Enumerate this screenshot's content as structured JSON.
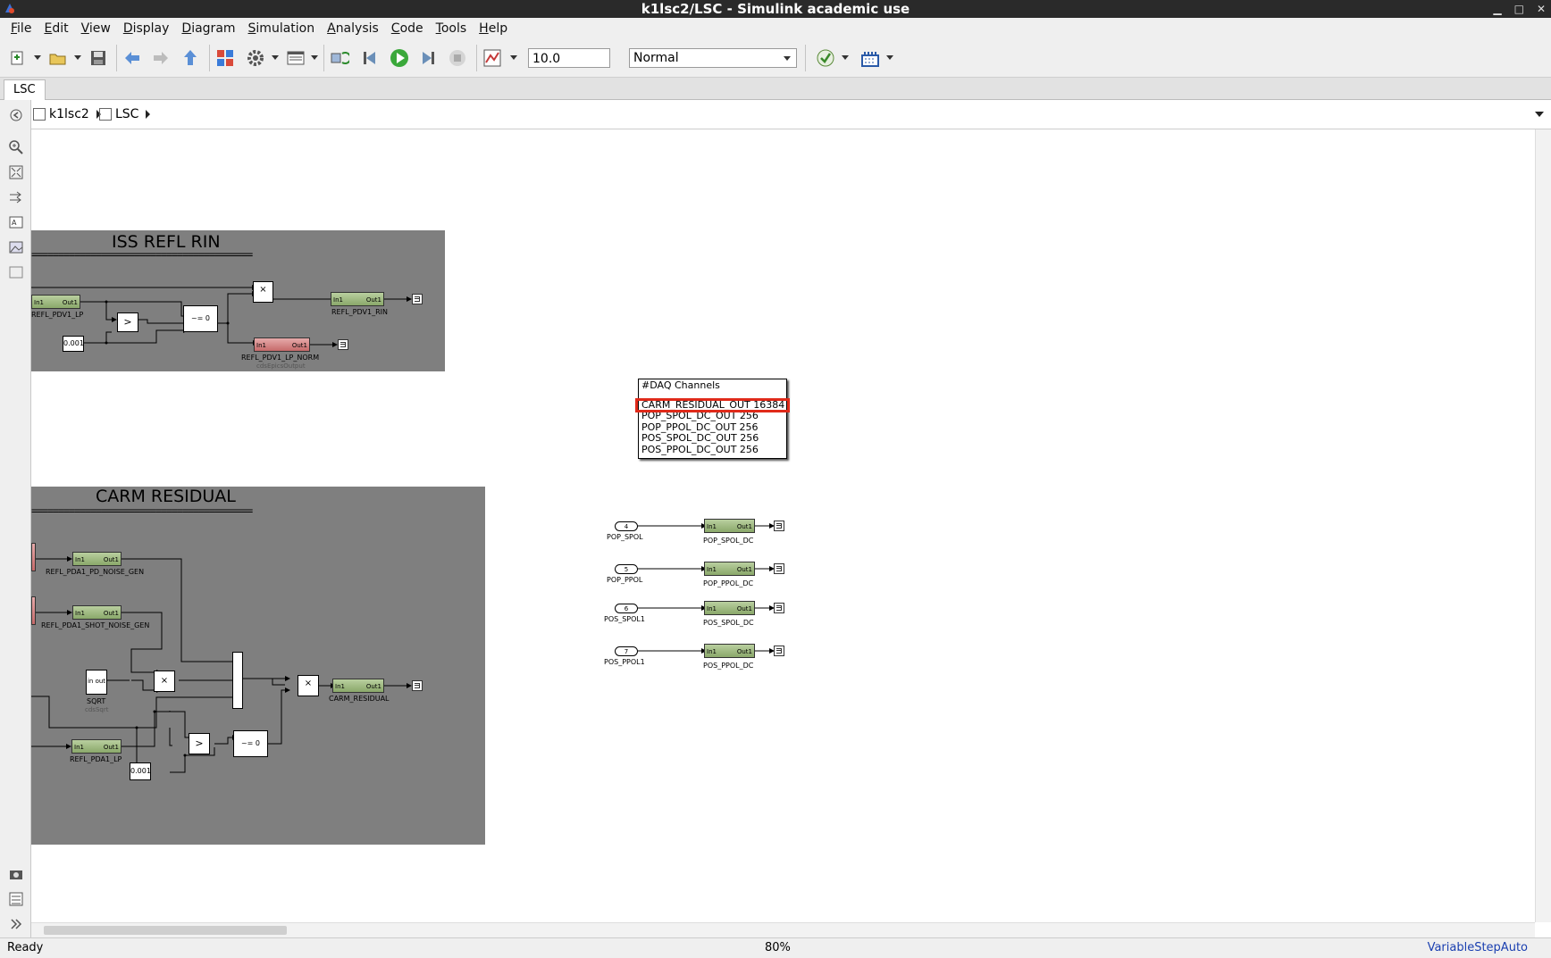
{
  "window": {
    "title": "k1lsc2/LSC - Simulink academic use"
  },
  "menu": [
    "File",
    "Edit",
    "View",
    "Display",
    "Diagram",
    "Simulation",
    "Analysis",
    "Code",
    "Tools",
    "Help"
  ],
  "toolbar": {
    "stop_time": "10.0",
    "sim_mode": "Normal",
    "icons": [
      "new-model-icon",
      "open-icon",
      "save-icon",
      "back-icon",
      "forward-icon",
      "up-icon",
      "library-browser-icon",
      "model-settings-icon",
      "model-explorer-icon",
      "update-diagram-icon",
      "step-back-icon",
      "run-icon",
      "step-forward-icon",
      "stop-icon",
      "data-inspector-icon",
      "model-advisor-icon",
      "build-icon"
    ]
  },
  "tabs": [
    {
      "label": "LSC"
    }
  ],
  "breadcrumb": {
    "items": [
      {
        "label": "k1lsc2"
      },
      {
        "label": "LSC"
      }
    ]
  },
  "diagram": {
    "iss_area": {
      "title": "ISS REFL RIN",
      "rule": "=========================================",
      "blocks": {
        "refl_pdv1_lp": "REFL_PDV1_LP",
        "refl_pdv1_rin": "REFL_PDV1_RIN",
        "refl_pdv1_lp_norm": "REFL_PDV1_LP_NORM",
        "refl_pdv1_lp_norm_sub": "cdsEpicsOutput",
        "const": "0.001",
        "compare": ">",
        "switch": "~= 0",
        "product": "×"
      }
    },
    "carm_area": {
      "title": "CARM RESIDUAL",
      "rule": "=========================================",
      "blocks": {
        "pd_noise": "REFL_PDA1_PD_NOISE_GEN",
        "shot_noise": "REFL_PDA1_SHOT_NOISE_GEN",
        "sqrt": "SQRT",
        "sqrt_sub": "cdsSqrt",
        "sqrt_in": "in",
        "sqrt_out": "out",
        "carm_residual": "CARM_RESIDUAL",
        "refl_pda1_lp": "REFL_PDA1_LP",
        "const": "0.001",
        "compare": ">",
        "switch": "~= 0",
        "product": "×"
      }
    },
    "block_ports": {
      "in": "In1",
      "out": "Out1"
    },
    "daq": {
      "header": "#DAQ Channels",
      "channels": [
        "CARM_RESIDUAL_OUT 16384",
        "POP_SPOL_DC_OUT 256",
        "POP_PPOL_DC_OUT 256",
        "POS_SPOL_DC_OUT 256",
        "POS_PPOL_DC_OUT 256"
      ]
    },
    "io_rows": [
      {
        "port": "4",
        "port_label": "POP_SPOL",
        "block": "POP_SPOL_DC"
      },
      {
        "port": "5",
        "port_label": "POP_PPOL",
        "block": "POP_PPOL_DC"
      },
      {
        "port": "6",
        "port_label": "POS_SPOL1",
        "block": "POS_SPOL_DC"
      },
      {
        "port": "7",
        "port_label": "POS_PPOL1",
        "block": "POS_PPOL_DC"
      }
    ]
  },
  "status": {
    "left": "Ready",
    "zoom": "80%",
    "solver": "VariableStepAuto"
  },
  "colors": {
    "highlight": "#e02a1a",
    "area_bg": "#7f7f7f",
    "block_green": "#8aa86a",
    "block_red": "#c66a6a"
  }
}
